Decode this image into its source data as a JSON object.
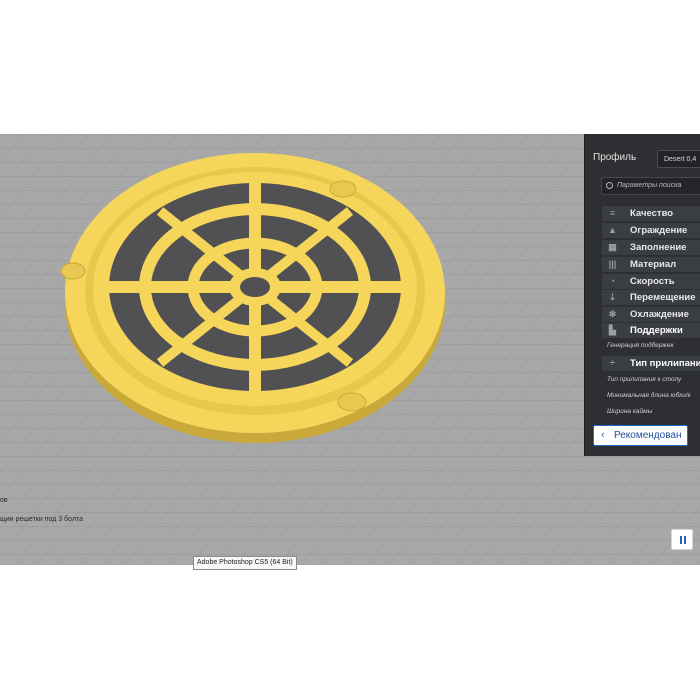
{
  "panel": {
    "profile_label": "Профиль",
    "profile_value": "Desert 0,4",
    "search_placeholder": "Параметры поиска",
    "categories": [
      {
        "label": "Качество",
        "icon": "quality-icon"
      },
      {
        "label": "Ограждение",
        "icon": "shell-icon"
      },
      {
        "label": "Заполнение",
        "icon": "infill-icon"
      },
      {
        "label": "Материал",
        "icon": "material-icon"
      },
      {
        "label": "Скорость",
        "icon": "speed-icon"
      },
      {
        "label": "Перемещение",
        "icon": "travel-icon"
      },
      {
        "label": "Охлаждение",
        "icon": "cooling-icon"
      },
      {
        "label": "Поддержки",
        "icon": "support-icon"
      },
      {
        "label": "Тип прилипания",
        "icon": "adhesion-icon"
      }
    ],
    "settings": {
      "support_generation": "Генерация поддержек",
      "adhesion_type": "Тип прилипания к столу",
      "min_skirt_length": "Минимальная длина юбки/к",
      "brim_width": "Ширина каймы"
    },
    "recommended_button": "Рекомендован"
  },
  "viewport": {
    "object_info_1": "ов",
    "object_info_2": "щии решетки под 3 болта"
  },
  "taskbar_tooltip": "Adobe Photoshop CS5 (64 Bit)",
  "colors": {
    "model": "#f6d65a",
    "build_plate": "#a8a8a8",
    "panel_bg": "#2d2f32",
    "accent": "#1f6fd0"
  }
}
